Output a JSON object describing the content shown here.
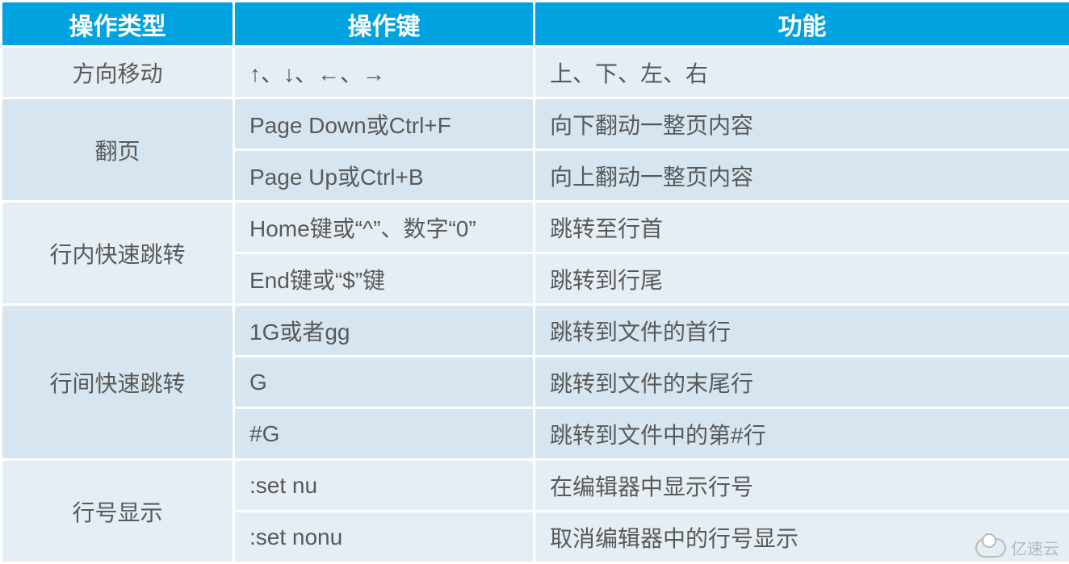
{
  "table": {
    "headers": [
      "操作类型",
      "操作键",
      "功能"
    ],
    "groups": [
      {
        "type": "方向移动",
        "shade": "shade-a",
        "rows": [
          {
            "key": "↑、↓、←、→",
            "func": "上、下、左、右"
          }
        ]
      },
      {
        "type": "翻页",
        "shade": "shade-b",
        "rows": [
          {
            "key": "Page Down或Ctrl+F",
            "func": "向下翻动一整页内容"
          },
          {
            "key": "Page Up或Ctrl+B",
            "func": "向上翻动一整页内容"
          }
        ]
      },
      {
        "type": "行内快速跳转",
        "shade": "shade-a",
        "rows": [
          {
            "key": "Home键或“^”、数字“0”",
            "func": "跳转至行首"
          },
          {
            "key": "End键或“$”键",
            "func": "跳转到行尾"
          }
        ]
      },
      {
        "type": "行间快速跳转",
        "shade": "shade-b",
        "rows": [
          {
            "key": "1G或者gg",
            "func": "跳转到文件的首行"
          },
          {
            "key": "G",
            "func": "跳转到文件的末尾行"
          },
          {
            "key": "#G",
            "func": "跳转到文件中的第#行"
          }
        ]
      },
      {
        "type": "行号显示",
        "shade": "shade-a",
        "rows": [
          {
            "key": ":set nu",
            "func": "在编辑器中显示行号"
          },
          {
            "key": ":set nonu",
            "func": "取消编辑器中的行号显示"
          }
        ]
      }
    ]
  },
  "watermark": "亿速云"
}
